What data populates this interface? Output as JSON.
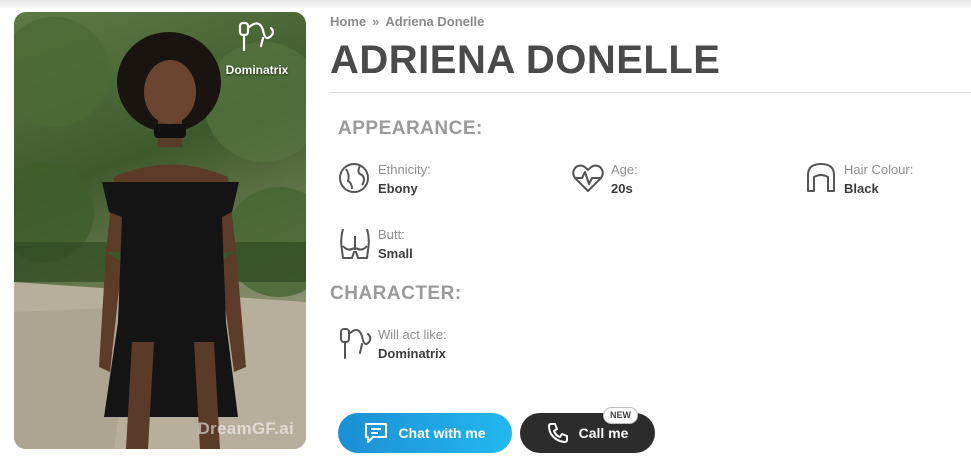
{
  "photo": {
    "badge_label": "Dominatrix",
    "badge_icon": "whip-icon",
    "watermark": "DreamGF.ai"
  },
  "breadcrumb": {
    "home": "Home",
    "separator": "»",
    "current": "Adriena Donelle"
  },
  "profile": {
    "name": "ADRIENA DONELLE"
  },
  "appearance": {
    "heading": "APPEARANCE:",
    "ethnicity": {
      "label": "Ethnicity:",
      "value": "Ebony",
      "icon": "globe-icon"
    },
    "age": {
      "label": "Age:",
      "value": "20s",
      "icon": "heart-pulse-icon"
    },
    "hair": {
      "label": "Hair Colour:",
      "value": "Black",
      "icon": "hair-icon"
    },
    "butt": {
      "label": "Butt:",
      "value": "Small",
      "icon": "butt-icon"
    }
  },
  "character": {
    "heading": "CHARACTER:",
    "acts_like": {
      "label": "Will act like:",
      "value": "Dominatrix",
      "icon": "whip-icon"
    }
  },
  "actions": {
    "chat_label": "Chat with me",
    "call_label": "Call me",
    "new_tag": "NEW",
    "chat_color": "#1c8fd4",
    "call_color": "#2c2c2c"
  }
}
